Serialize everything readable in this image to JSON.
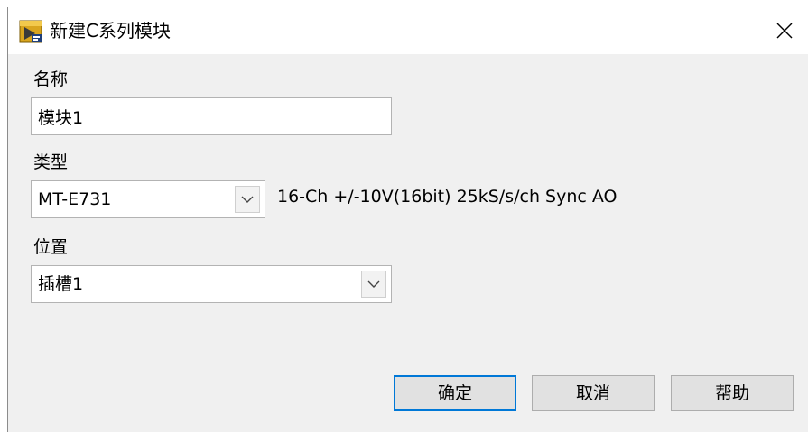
{
  "window": {
    "title": "新建C系列模块"
  },
  "form": {
    "name_label": "名称",
    "name_value": "模块1",
    "type_label": "类型",
    "type_selected": "MT-E731",
    "type_description": "16-Ch +/-10V(16bit) 25kS/s/ch Sync AO",
    "location_label": "位置",
    "location_selected": "插槽1"
  },
  "buttons": {
    "ok": "确定",
    "cancel": "取消",
    "help": "帮助"
  },
  "colors": {
    "dialog_bg": "#f0f0f0",
    "default_button_border": "#0078d7",
    "button_bg": "#e1e1e1"
  },
  "icons": {
    "app": "labview-app-icon",
    "close": "close-icon",
    "dropdown": "chevron-down-icon"
  }
}
